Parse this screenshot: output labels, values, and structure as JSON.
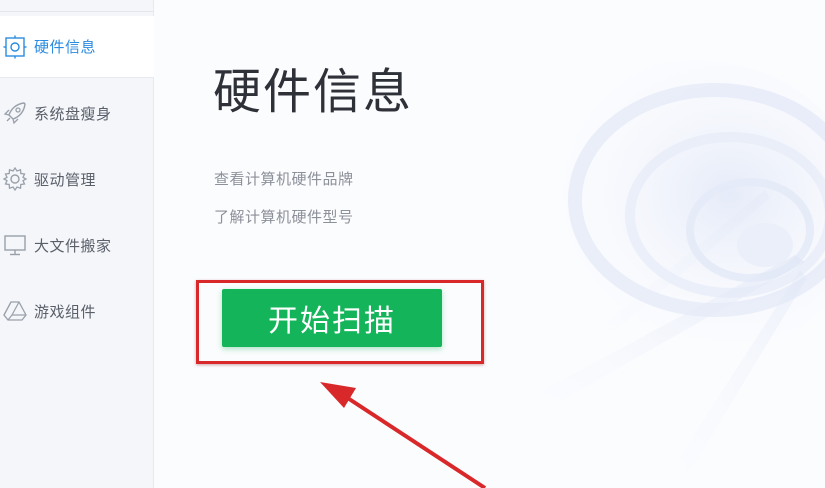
{
  "sidebar": {
    "items": [
      {
        "label": "硬件信息",
        "icon": "hardware-icon",
        "active": true
      },
      {
        "label": "系统盘瘦身",
        "icon": "rocket-icon",
        "active": false
      },
      {
        "label": "驱动管理",
        "icon": "gear-icon",
        "active": false
      },
      {
        "label": "大文件搬家",
        "icon": "monitor-icon",
        "active": false
      },
      {
        "label": "游戏组件",
        "icon": "triangle-icon",
        "active": false
      }
    ]
  },
  "main": {
    "title": "硬件信息",
    "desc_1": "查看计算机硬件品牌",
    "desc_2": "了解计算机硬件型号",
    "scan_button_label": "开始扫描"
  },
  "colors": {
    "accent_blue": "#2a8be0",
    "scan_green": "#14b55a",
    "annotation_red": "#d9282a"
  }
}
